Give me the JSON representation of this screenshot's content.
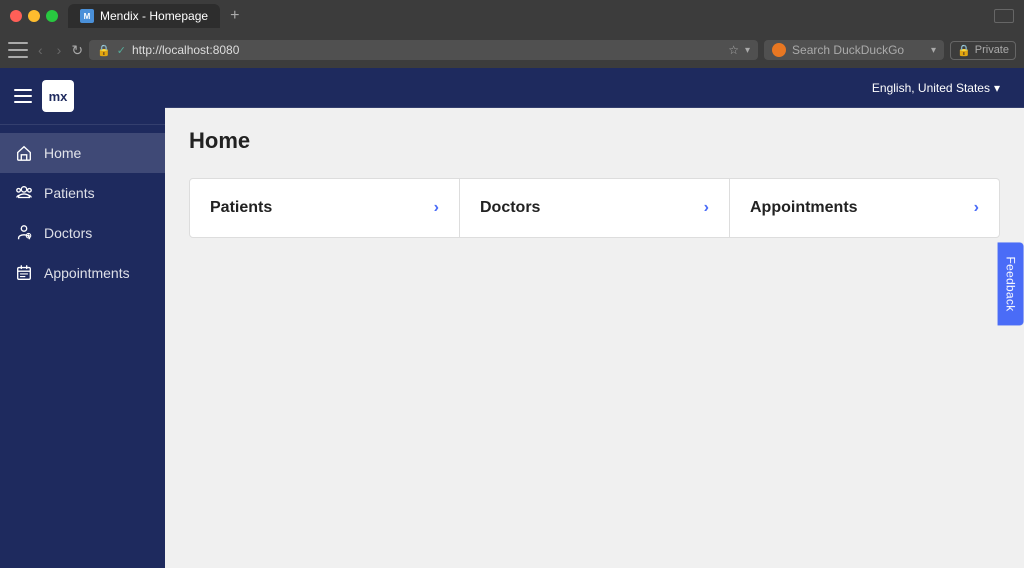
{
  "browser": {
    "tab_title": "Mendix - Homepage",
    "tab_add_label": "+",
    "back_btn": "‹",
    "forward_btn": "›",
    "reload_btn": "↻",
    "address": "http://localhost:8080",
    "shield_icon": "🔒",
    "bookmark_icon": "☆",
    "search_placeholder": "Search DuckDuckGo",
    "private_label": "Private",
    "lock_icon": "🔒"
  },
  "topbar": {
    "language": "English, United States",
    "chevron": "▾"
  },
  "sidebar": {
    "logo": "mx",
    "items": [
      {
        "id": "home",
        "label": "Home",
        "icon": "home"
      },
      {
        "id": "patients",
        "label": "Patients",
        "icon": "patients"
      },
      {
        "id": "doctors",
        "label": "Doctors",
        "icon": "doctors"
      },
      {
        "id": "appointments",
        "label": "Appointments",
        "icon": "appointments"
      }
    ]
  },
  "main": {
    "page_title": "Home",
    "cards": [
      {
        "id": "patients",
        "label": "Patients",
        "arrow": "›"
      },
      {
        "id": "doctors",
        "label": "Doctors",
        "arrow": "›"
      },
      {
        "id": "appointments",
        "label": "Appointments",
        "arrow": "›"
      }
    ]
  },
  "feedback": {
    "label": "Feedback"
  }
}
